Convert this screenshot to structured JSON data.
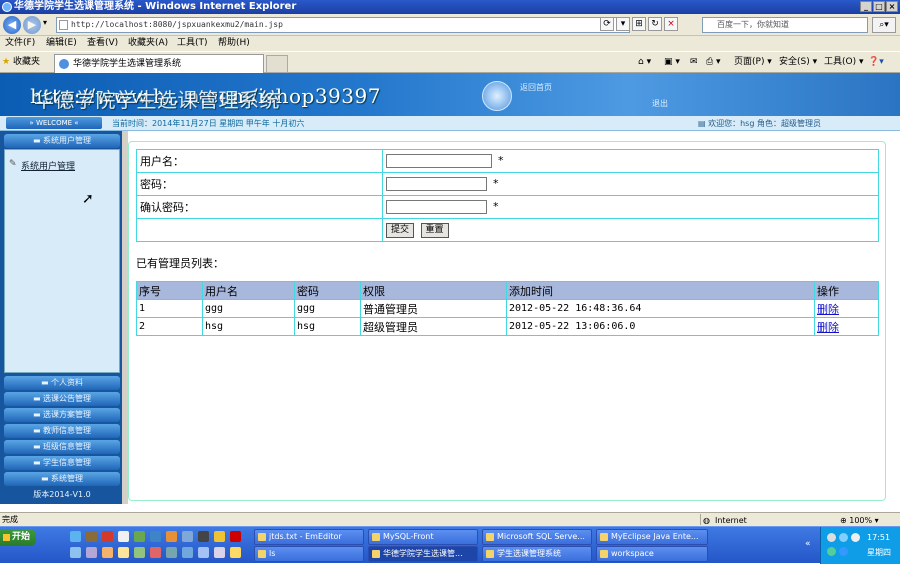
{
  "browser": {
    "window_title": "华德学院学生选课管理系统 - Windows Internet Explorer",
    "url": "http://localhost:8080/jspxuankexmu2/main.jsp",
    "search_placeholder": "百度一下，你就知道",
    "menu": [
      "文件(F)",
      "编辑(E)",
      "查看(V)",
      "收藏夹(A)",
      "工具(T)",
      "帮助(H)"
    ],
    "favorites_label": "收藏夹",
    "tab_title": "华德学院学生选课管理系统",
    "commands": [
      "页面(P) ▾",
      "安全(S) ▾",
      "工具(O) ▾"
    ],
    "status_text": "完成",
    "zone": "Internet",
    "zoom": "100%"
  },
  "banner": {
    "watermark": "http://www.h...n.com/ishop39397",
    "title_overlay": "华德学院学生选课管理系统",
    "link1": "返回首页",
    "link2": "退出"
  },
  "welcome_bar": {
    "welcome_button": "WELCOME",
    "current_time": "当前时间：2014年11月27日 星期四 甲午年 十月初六",
    "user_info": "欢迎您：hsg 角色：超级管理员"
  },
  "sidebar": {
    "top_section": "系统用户管理",
    "active_item": "系统用户管理",
    "sections": [
      "个人资料",
      "选课公告管理",
      "选课方案管理",
      "教师信息管理",
      "班级信息管理",
      "学生信息管理",
      "系统管理"
    ],
    "version": "版本2014-V1.0"
  },
  "form": {
    "username_label": "用户名：",
    "password_label": "密码：",
    "confirm_label": "确认密码：",
    "required_mark": "*",
    "submit_label": "提交",
    "reset_label": "重置"
  },
  "list": {
    "title": "已有管理员列表：",
    "headers": [
      "序号",
      "用户名",
      "密码",
      "权限",
      "添加时间",
      "操作"
    ],
    "rows": [
      {
        "id": "1",
        "username": "ggg",
        "password": "ggg",
        "role": "普通管理员",
        "added": "2012-05-22 16:48:36.64",
        "action": "删除"
      },
      {
        "id": "2",
        "username": "hsg",
        "password": "hsg",
        "role": "超级管理员",
        "added": "2012-05-22 13:06:06.0",
        "action": "删除"
      }
    ]
  },
  "taskbar": {
    "start": "开始",
    "tasks_row1": [
      "jtds.txt - EmEditor",
      "MySQL-Front",
      "Microsoft SQL Serve...",
      "MyEclipse Java Ente..."
    ],
    "tasks_row2": [
      "ls",
      "华德学院学生选课管...",
      "学生选课管理系统",
      "workspace"
    ],
    "clock": "17:51",
    "day": "星期四"
  },
  "colors": {
    "banner": "#2377cc",
    "sidebar": "#17559e",
    "table_header": "#a8b7dc",
    "table_border": "#44d8e0",
    "taskbar": "#2456c8"
  }
}
